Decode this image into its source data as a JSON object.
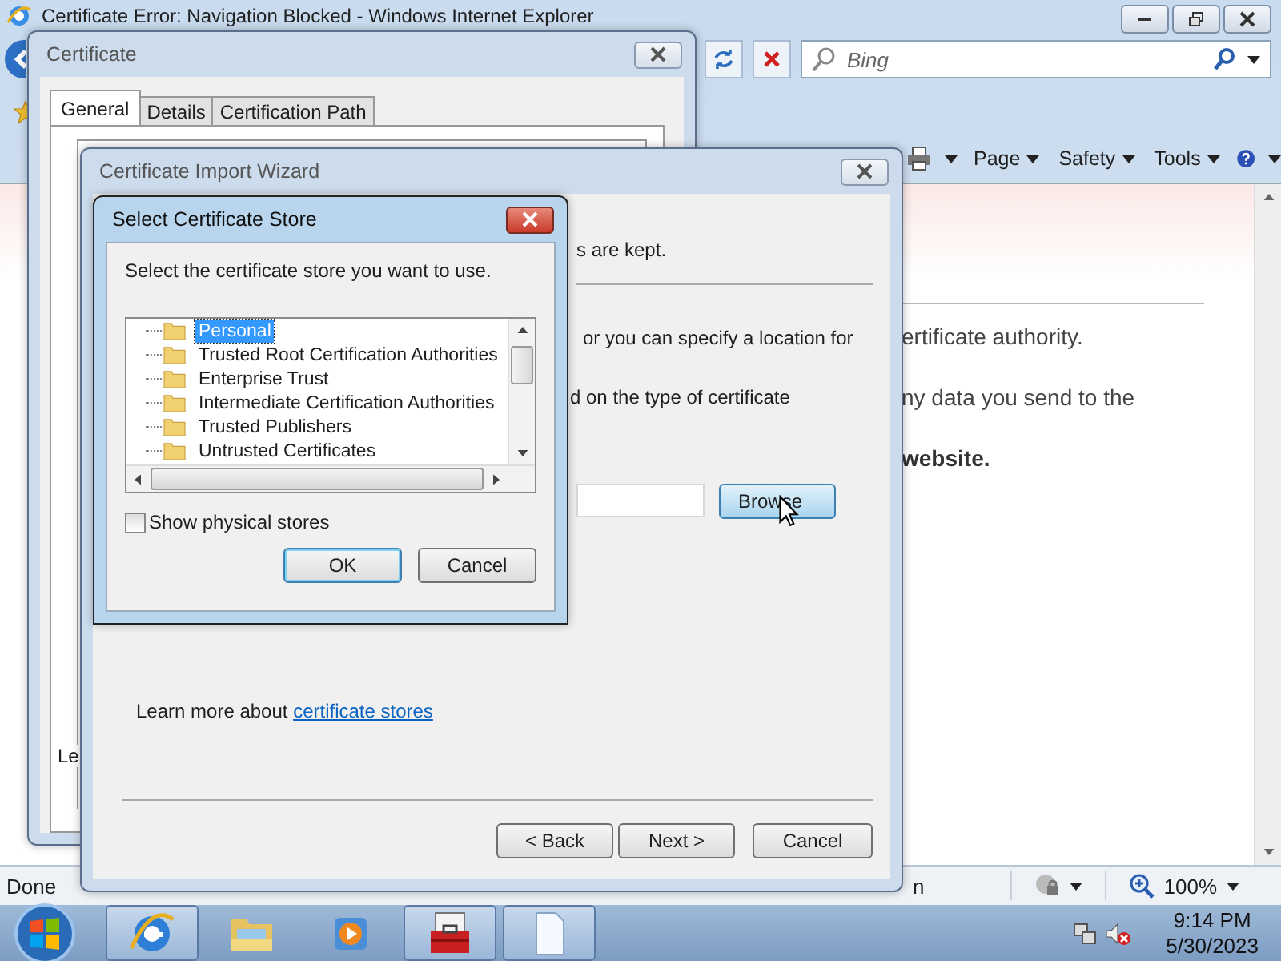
{
  "browser": {
    "title": "Certificate Error: Navigation Blocked - Windows Internet Explorer",
    "search": {
      "placeholder": "Bing"
    },
    "commands": [
      "Page",
      "Safety",
      "Tools"
    ],
    "page_lines": [
      {
        "text": "ertificate authority.",
        "bold": false
      },
      {
        "text": "ny data you send to the",
        "bold": false
      },
      {
        "text": "website.",
        "bold": true
      }
    ],
    "status": {
      "text": "Done",
      "fragment": "n",
      "zoom": "100%"
    }
  },
  "certificate_dialog": {
    "title": "Certificate",
    "tabs": [
      {
        "label": "General",
        "selected": true
      },
      {
        "label": "Details",
        "selected": false
      },
      {
        "label": "Certification Path",
        "selected": false
      }
    ],
    "fragment": "Le"
  },
  "import_wizard": {
    "title": "Certificate Import Wizard",
    "fragments": [
      "s are kept.",
      "or you can specify a location for",
      "d on the type of certificate"
    ],
    "browse_button": "Browse",
    "learn_more": {
      "text": "Learn more about",
      "link": "certificate stores"
    },
    "buttons": [
      "< Back",
      "Next >",
      "Cancel"
    ]
  },
  "store_dialog": {
    "title": "Select Certificate Store",
    "prompt": "Select the certificate store you want to use.",
    "stores": [
      {
        "name": "Personal",
        "selected": true
      },
      {
        "name": "Trusted Root Certification Authorities",
        "selected": false
      },
      {
        "name": "Enterprise Trust",
        "selected": false
      },
      {
        "name": "Intermediate Certification Authorities",
        "selected": false
      },
      {
        "name": "Trusted Publishers",
        "selected": false
      },
      {
        "name": "Untrusted Certificates",
        "selected": false
      }
    ],
    "show_physical_stores": {
      "label": "Show physical stores",
      "checked": false
    },
    "buttons": [
      {
        "label": "OK",
        "default": true
      },
      {
        "label": "Cancel",
        "default": false
      }
    ]
  },
  "taskbar": {
    "apps": [
      {
        "kind": "browser",
        "active": true
      },
      {
        "kind": "explorer",
        "active": false
      },
      {
        "kind": "media",
        "active": false
      },
      {
        "kind": "toolbox",
        "active": true
      },
      {
        "kind": "document",
        "active": true
      }
    ],
    "time": "9:14 PM",
    "date": "5/30/2023"
  }
}
